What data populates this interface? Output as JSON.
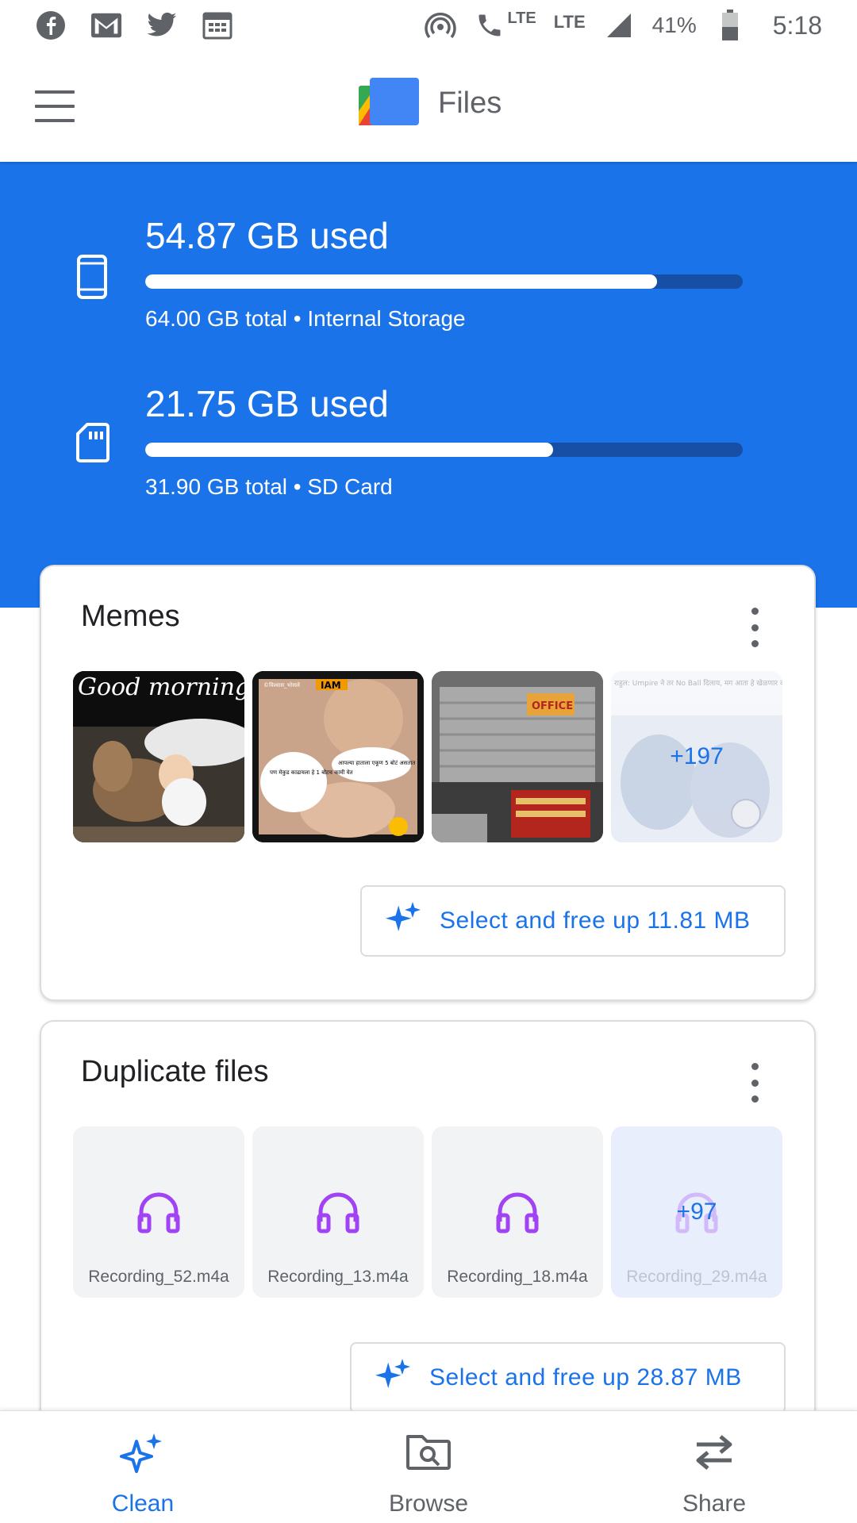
{
  "status_bar": {
    "battery": "41%",
    "time": "5:18",
    "network_label_1": "LTE",
    "network_label_2": "LTE",
    "left_icons": [
      "facebook-icon",
      "gmail-icon",
      "twitter-icon",
      "calendar-icon"
    ],
    "right_icons": [
      "hotspot-icon",
      "volte-call-icon",
      "signal-icon",
      "battery-icon"
    ]
  },
  "app_bar": {
    "title": "Files",
    "menu_icon": "hamburger-menu-icon",
    "logo": "files-logo"
  },
  "storage": [
    {
      "used": "54.87 GB used",
      "caption": "64.00 GB total • Internal Storage",
      "fraction": 0.857,
      "icon": "phone-icon"
    },
    {
      "used": "21.75 GB used",
      "caption": "31.90 GB total • SD Card",
      "fraction": 0.682,
      "icon": "sd-card-icon"
    }
  ],
  "memes_card": {
    "title": "Memes",
    "more_count": "+197",
    "button_label": "Select and free up 11.81 MB",
    "thumbs": [
      {
        "caption": "Good morning",
        "kind": "child-with-calf"
      },
      {
        "caption": "IAM",
        "kind": "actress-meme",
        "bubble_1": "पण मेकुड काढायला हे 1 बोटच कामी येत",
        "bubble_2": "आपल्या हाताला एकूण 5 बोटं असतात",
        "watermark": "©विश्वास_भोसले"
      },
      {
        "caption": "OFFICE",
        "kind": "shop-shutter"
      },
      {
        "caption": "राहुल: Umpire ने तर No Ball दिलाय, मग आता हे खेळणार कशाने? सचिन: तु plz निघ इथुन",
        "kind": "cricket-meme"
      }
    ]
  },
  "duplicates_card": {
    "title": "Duplicate files",
    "more_count": "+97",
    "button_label": "Select and free up 28.87 MB",
    "files": [
      "Recording_52.m4a",
      "Recording_13.m4a",
      "Recording_18.m4a",
      "Recording_29.m4a"
    ]
  },
  "bottom_nav": {
    "items": [
      {
        "label": "Clean",
        "icon": "sparkle-icon",
        "active": true
      },
      {
        "label": "Browse",
        "icon": "folder-search-icon",
        "active": false
      },
      {
        "label": "Share",
        "icon": "swap-arrows-icon",
        "active": false
      }
    ]
  },
  "colors": {
    "primary": "#1a73e8",
    "primary_dark": "#174ea6",
    "audio_icon": "#a142f4",
    "text_secondary": "#5f6368"
  }
}
